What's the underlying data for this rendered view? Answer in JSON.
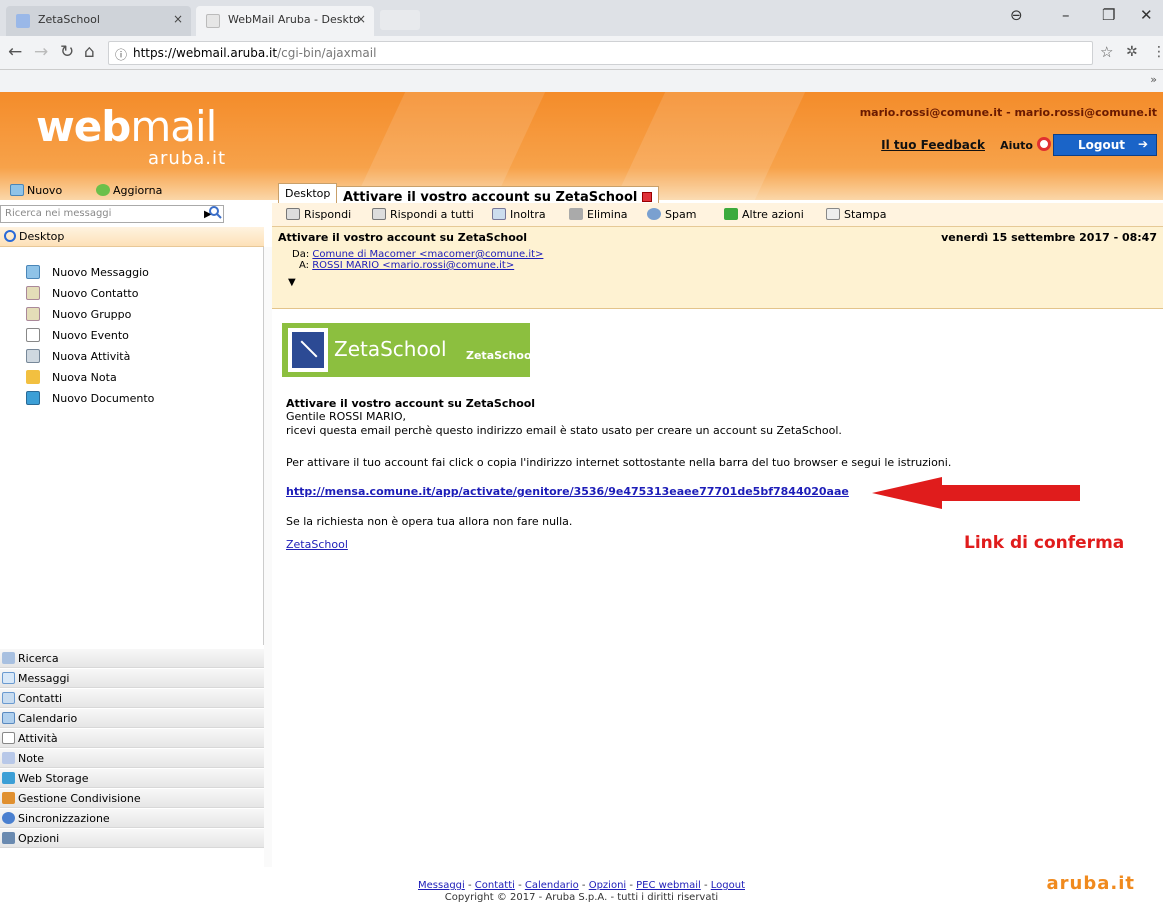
{
  "browser": {
    "tabs": [
      {
        "title": "ZetaSchool",
        "close": "×"
      },
      {
        "title": "WebMail Aruba - Deskto",
        "close": "×"
      }
    ],
    "url_domain": "https://webmail.aruba.it",
    "url_path": "/cgi-bin/ajaxmail",
    "bookmarks_more": "»"
  },
  "header": {
    "logo_web": "web",
    "logo_mail": "mail",
    "logo_aruba": "aruba.it",
    "user": "mario.rossi@comune.it - mario.rossi@comune.it",
    "feedback": "Il tuo Feedback",
    "help": "Aiuto",
    "logout": "Logout"
  },
  "left": {
    "new_label": "Nuovo",
    "refresh_label": "Aggiorna",
    "search_placeholder": "Ricerca nei messaggi",
    "desktop_label": "Desktop",
    "new_items": [
      "Nuovo Messaggio",
      "Nuovo Contatto",
      "Nuovo Gruppo",
      "Nuovo Evento",
      "Nuova Attività",
      "Nuova Nota",
      "Nuovo Documento"
    ],
    "nav": [
      "Ricerca",
      "Messaggi",
      "Contatti",
      "Calendario",
      "Attività",
      "Note",
      "Web Storage",
      "Gestione Condivisione",
      "Sincronizzazione",
      "Opzioni"
    ]
  },
  "main": {
    "tab_desktop": "Desktop",
    "tab_active": "Attivare il vostro account su ZetaSchool",
    "actions": [
      "Rispondi",
      "Rispondi a tutti",
      "Inoltra",
      "Elimina",
      "Spam",
      "Altre azioni",
      "Stampa"
    ],
    "subject": "Attivare il vostro account su ZetaSchool",
    "date": "venerdì 15 settembre 2017 - 08:47",
    "from_prefix": "Da:",
    "from": "Comune di Macomer <macomer@comune.it>",
    "to_prefix": "A:",
    "to": "ROSSI MARIO <mario.rossi@comune.it>",
    "toggle": "▼"
  },
  "email": {
    "banner_name": "ZetaSchool",
    "banner_sub": "ZetaSchool",
    "heading": "Attivare il vostro account su ZetaSchool",
    "greeting": "Gentile ROSSI MARIO,",
    "line1": "ricevi questa email perchè questo indirizzo email è stato usato per creare un account su ZetaSchool.",
    "line2": "Per attivare il tuo account fai click o copia l'indirizzo internet sottostante nella barra del tuo browser e segui le istruzioni.",
    "link": "http://mensa.comune.it/app/activate/genitore/3536/9e475313eaee77701de5bf7844020aae",
    "line3": "Se la richiesta non è opera tua allora non fare nulla.",
    "signature": "ZetaSchool",
    "annotation": "Link di conferma"
  },
  "footer": {
    "links": [
      "Messaggi",
      "Contatti",
      "Calendario",
      "Opzioni",
      "PEC webmail",
      "Logout"
    ],
    "separator": " - ",
    "copyright": "Copyright © 2017 - Aruba S.p.A. - tutti i diritti riservati",
    "logo": "aruba.it"
  }
}
